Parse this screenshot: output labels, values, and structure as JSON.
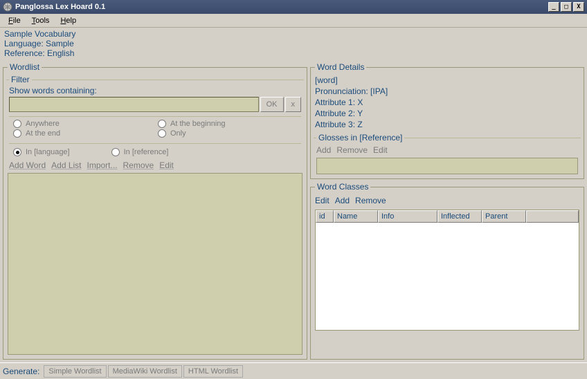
{
  "window": {
    "title": "Panglossa Lex Hoard 0.1"
  },
  "menubar": {
    "file": "File",
    "tools": "Tools",
    "help": "Help"
  },
  "header": {
    "vocab": "Sample Vocabulary",
    "language": "Language: Sample",
    "reference": "Reference: English"
  },
  "wordlist": {
    "legend": "Wordlist",
    "filter_legend": "Filter",
    "show_label": "Show words containing:",
    "ok": "OK",
    "x": "x",
    "radios": {
      "anywhere": "Anywhere",
      "beginning": "At the beginning",
      "end": "At the end",
      "only": "Only"
    },
    "scope": {
      "in_language": "In [language]",
      "in_reference": "In [reference]"
    },
    "toolbar": {
      "add_word": "Add Word",
      "add_list": "Add List",
      "import": "Import...",
      "remove": "Remove",
      "edit": "Edit"
    }
  },
  "word_details": {
    "legend": "Word Details",
    "word": "[word]",
    "pron": "Pronunciation: [IPA]",
    "a1": "Attribute 1: X",
    "a2": "Attribute 2: Y",
    "a3": "Attribute 3: Z"
  },
  "glosses": {
    "legend": "Glosses in [Reference]",
    "add": "Add",
    "remove": "Remove",
    "edit": "Edit"
  },
  "word_classes": {
    "legend": "Word Classes",
    "edit": "Edit",
    "add": "Add",
    "remove": "Remove",
    "cols": {
      "id": "id",
      "name": "Name",
      "info": "Info",
      "inflected": "Inflected",
      "parent": "Parent"
    }
  },
  "generate": {
    "label": "Generate:",
    "simple": "Simple Wordlist",
    "mediawiki": "MediaWiki Wordlist",
    "html": "HTML Wordlist"
  }
}
